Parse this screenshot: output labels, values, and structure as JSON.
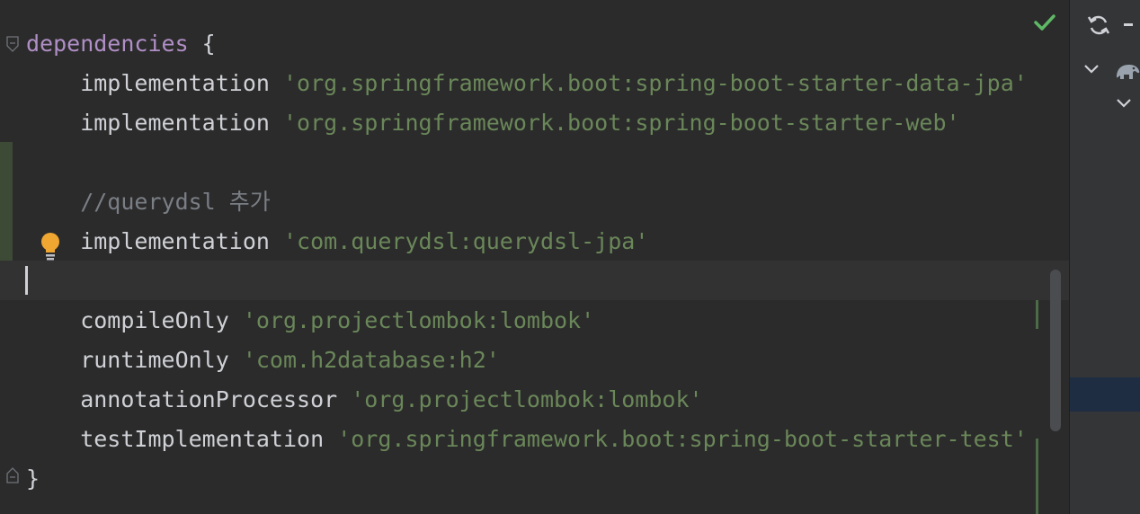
{
  "editor": {
    "lines": [
      {
        "parts": [
          {
            "cls": "kw-deps",
            "text": "dependencies"
          },
          {
            "cls": "brace",
            "text": " {"
          }
        ]
      },
      {
        "parts": [
          {
            "cls": "fn",
            "text": "    implementation "
          },
          {
            "cls": "str",
            "text": "'org.springframework.boot:spring-boot-starter-data-jpa'"
          }
        ]
      },
      {
        "parts": [
          {
            "cls": "fn",
            "text": "    implementation "
          },
          {
            "cls": "str",
            "text": "'org.springframework.boot:spring-boot-starter-web'"
          }
        ]
      },
      {
        "parts": []
      },
      {
        "parts": [
          {
            "cls": "comment",
            "text": "    //querydsl 추가"
          }
        ]
      },
      {
        "parts": [
          {
            "cls": "fn",
            "text": "    implementation "
          },
          {
            "cls": "str",
            "text": "'com.querydsl:querydsl-jpa'"
          }
        ]
      },
      {
        "parts": []
      },
      {
        "parts": [
          {
            "cls": "fn",
            "text": "    compileOnly "
          },
          {
            "cls": "str",
            "text": "'org.projectlombok:lombok'"
          }
        ]
      },
      {
        "parts": [
          {
            "cls": "fn",
            "text": "    runtimeOnly "
          },
          {
            "cls": "str",
            "text": "'com.h2database:h2'"
          }
        ]
      },
      {
        "parts": [
          {
            "cls": "fn",
            "text": "    annotationProcessor "
          },
          {
            "cls": "str",
            "text": "'org.projectlombok:lombok'"
          }
        ]
      },
      {
        "parts": [
          {
            "cls": "fn",
            "text": "    testImplementation "
          },
          {
            "cls": "str",
            "text": "'org.springframework.boot:spring-boot-starter-test'"
          }
        ]
      },
      {
        "parts": [
          {
            "cls": "brace",
            "text": "}"
          }
        ]
      }
    ],
    "current_line_index": 6
  },
  "icons": {
    "fold_open": "fold-open-icon",
    "fold_close": "fold-close-icon",
    "intention": "lightbulb-icon",
    "inspection_ok": "checkmark-icon",
    "sync": "sync-icon",
    "gradle": "gradle-elephant-icon"
  },
  "colors": {
    "background": "#2b2b2b",
    "keyword": "#b08fc7",
    "string": "#6a8759",
    "comment": "#7a7e85",
    "check": "#5fb865",
    "bulb": "#f0a732"
  }
}
